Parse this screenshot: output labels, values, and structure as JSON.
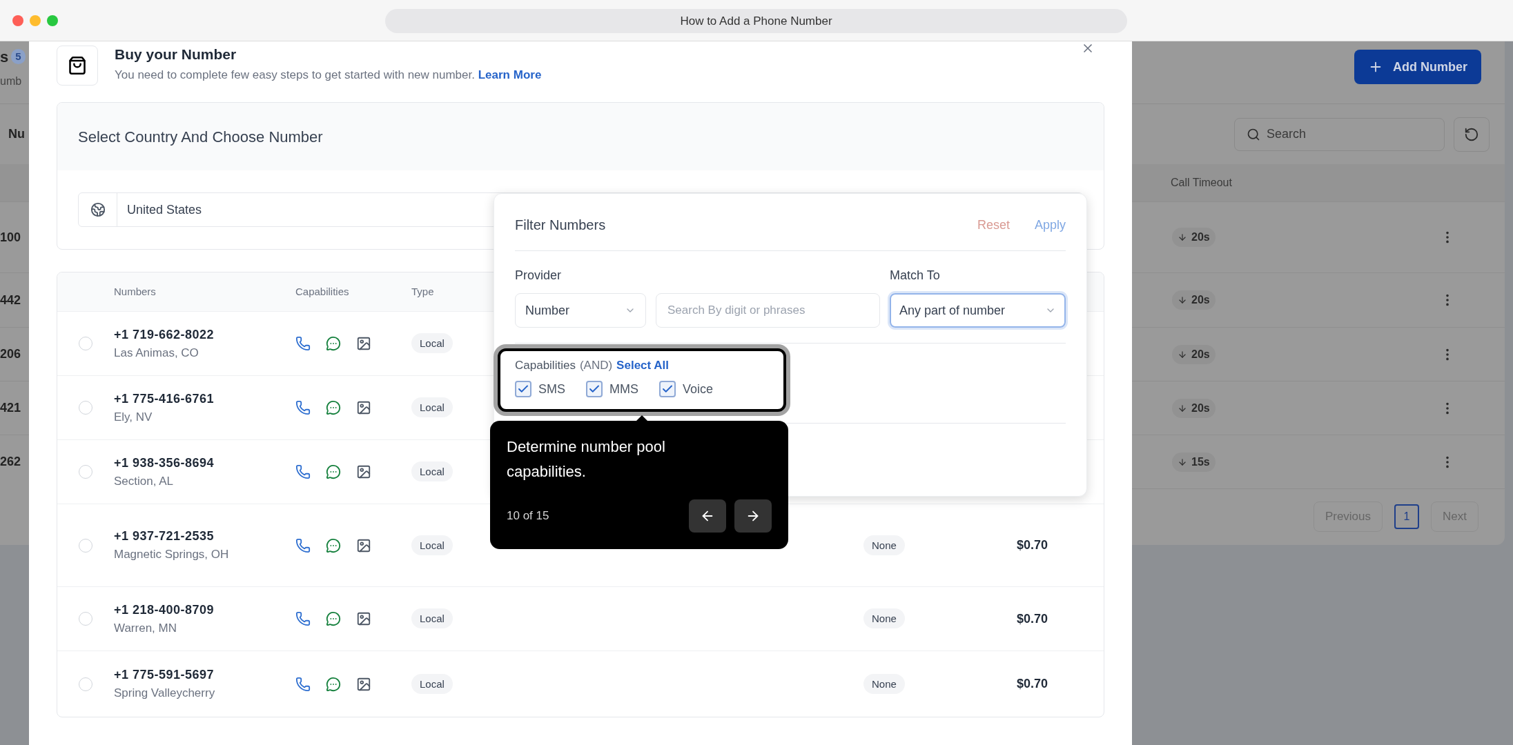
{
  "window": {
    "title": "How to Add a Phone Number"
  },
  "background": {
    "header": {
      "title_fragment": "s",
      "count": "5",
      "subtitle_fragment": "umb",
      "add_button": "Add Number"
    },
    "toolbar": {
      "tab_fragment": "Nu",
      "search_placeholder": "Search"
    },
    "table": {
      "column": "Call Timeout",
      "rows": [
        {
          "number_fragment": "100",
          "timeout": "20s"
        },
        {
          "number_fragment": "442",
          "timeout": "20s"
        },
        {
          "number_fragment": "206",
          "timeout": "20s"
        },
        {
          "number_fragment": "421",
          "timeout": "20s"
        },
        {
          "number_fragment": "262",
          "timeout": "15s"
        }
      ]
    },
    "pagination": {
      "previous": "Previous",
      "pages": [
        {
          "label": "1",
          "selected": true
        }
      ],
      "next": "Next"
    }
  },
  "modal": {
    "title": "Buy your Number",
    "subtitle": "You need to complete few easy steps to get started with new number.",
    "link": "Learn More",
    "country_section": {
      "title": "Select Country And Choose Number",
      "country": "United States"
    },
    "numbers_table": {
      "columns": [
        "Numbers",
        "Capabilities",
        "Type"
      ],
      "rows": [
        {
          "selected": false,
          "number": "+1 719-662-8022",
          "location": "Las Animas, CO",
          "type": "Local"
        },
        {
          "selected": false,
          "number": "+1 775-416-6761",
          "location": "Ely, NV",
          "type": "Local"
        },
        {
          "selected": false,
          "number": "+1 938-356-8694",
          "location": "Section, AL",
          "type": "Local"
        },
        {
          "selected": false,
          "number": "+1 937-721-2535",
          "location": "Magnetic Springs, OH",
          "type": "Local",
          "column_4": "None",
          "column_5": "$0.70"
        },
        {
          "selected": false,
          "number": "+1 218-400-8709",
          "location": "Warren, MN",
          "type": "Local",
          "column_4": "None",
          "column_5": "$0.70"
        },
        {
          "selected": false,
          "number": "+1 775-591-5697",
          "location": "Spring Valleycherry",
          "type": "Local",
          "column_4": "None",
          "column_5": "$0.70"
        }
      ]
    }
  },
  "filter": {
    "title": "Filter Numbers",
    "reset": "Reset",
    "apply": "Apply",
    "provider_label": "Provider",
    "provider": "Number",
    "search_placeholder": "Search By digit or phrases",
    "match_label": "Match To",
    "match": "Any part of number",
    "capabilities_label": "Capabilities",
    "capabilities_note": "(AND)",
    "select_all": "Select All",
    "capabilities": [
      {
        "label": "SMS",
        "checked": true
      },
      {
        "label": "MMS",
        "checked": true
      },
      {
        "label": "Voice",
        "checked": true
      }
    ]
  },
  "tour": {
    "text": "Determine number pool capabilities.",
    "progress": "10 of 15"
  }
}
